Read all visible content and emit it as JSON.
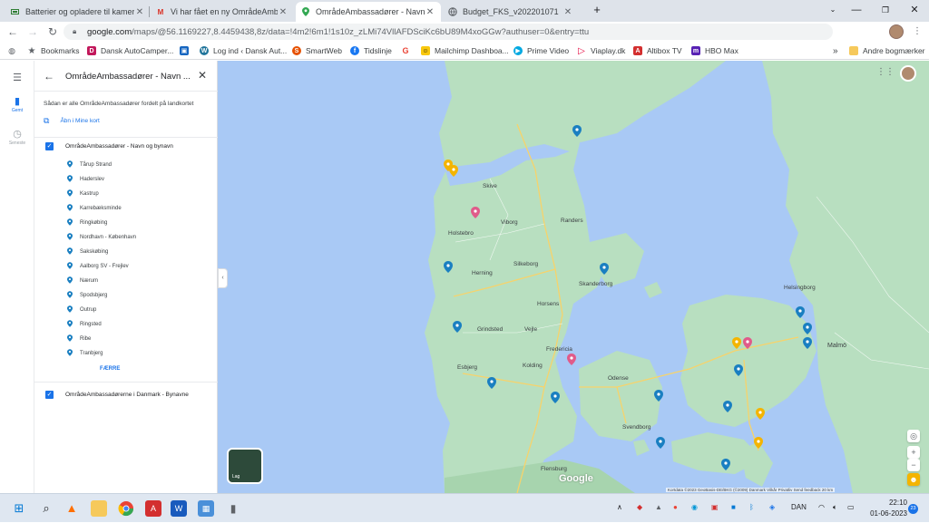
{
  "tabs": [
    {
      "title": "Batterier og opladere til kamerac",
      "icon": "battery-icon",
      "active": false
    },
    {
      "title": "Vi har fået en ny OmrådeAmbassa",
      "icon": "gmail-icon",
      "active": false
    },
    {
      "title": "OmrådeAmbassadører - Navn og",
      "icon": "maps-icon",
      "active": true
    },
    {
      "title": "Budget_FKS_v202201071",
      "icon": "web-icon",
      "active": false
    }
  ],
  "new_tab_label": "+",
  "address": {
    "host": "google.com",
    "path": "/maps/@56.1169227,8.4459438,8z/data=!4m2!6m1!1s10z_zLMi74VllAFDSciKc6bU89M4xoGGw?authuser=0&entry=ttu"
  },
  "bookmarks": [
    {
      "label": "Bookmarks",
      "icon": "star-icon",
      "color": "#5f6368"
    },
    {
      "label": "Dansk AutoCamper...",
      "icon": "camper-icon",
      "color": "#c2185b"
    },
    {
      "label": "",
      "icon": "store-icon",
      "color": "#1565c0"
    },
    {
      "label": "Log ind ‹ Dansk Aut...",
      "icon": "wordpress-icon",
      "color": "#21759b"
    },
    {
      "label": "SmartWeb",
      "icon": "smartweb-icon",
      "color": "#e65100"
    },
    {
      "label": "Tidslinje",
      "icon": "facebook-icon",
      "color": "#1877f2"
    },
    {
      "label": "",
      "icon": "google-icon",
      "color": "#ea4335"
    },
    {
      "label": "Mailchimp Dashboa...",
      "icon": "mailchimp-icon",
      "color": "#f9c80e"
    },
    {
      "label": "Prime Video",
      "icon": "prime-icon",
      "color": "#00a8e1"
    },
    {
      "label": "Viaplay.dk",
      "icon": "viaplay-icon",
      "color": "#e4003a"
    },
    {
      "label": "Altibox TV",
      "icon": "altibox-icon",
      "color": "#d32f2f"
    },
    {
      "label": "HBO Max",
      "icon": "hbo-icon",
      "color": "#5822b4"
    }
  ],
  "bookmarks_more": "»",
  "other_bookmarks": "Andre bogmærker",
  "rail": {
    "saved_label": "Gemt",
    "recent_label": "Seneste"
  },
  "panel": {
    "title": "OmrådeAmbassadører - Navn ...",
    "description": "Sådan er alle OmrådeAmbassadører fordelt på landkortet",
    "open_link": "Åbn i Mine kort",
    "layer1": "OmrådeAmbassadører - Navn og bynavn",
    "places": [
      "Tårup Strand",
      "Haderslev",
      "Kastrup",
      "Karrebæksminde",
      "Ringkøbing",
      "Nordhavn - København",
      "Sakskøbing",
      "Aalborg SV - Frejlev",
      "Nærum",
      "Spodsbjerg",
      "Outrup",
      "Ringsted",
      "Ribe",
      "Tranbjerg"
    ],
    "more_label": "FÆRRE",
    "layer2": "OmrådeAmbassadørerne i Danmark - Bynavne"
  },
  "map": {
    "layer_button": "Lag",
    "logo": "Google",
    "attribution": "Kortdata ©2023 GeoBasis-DE/BKG (©2009)  Danmark  Vilkår  Privatliv  Send feedback  20 km",
    "labels": [
      "Randers",
      "Horsens",
      "Vejle",
      "Fredericia",
      "Kolding",
      "Esbjerg",
      "Odense",
      "Svendborg",
      "Helsingborg",
      "Malmö",
      "Flensburg",
      "Viborg",
      "Herning",
      "Holstebro",
      "Skanderborg",
      "Skive",
      "Silkeborg",
      "Grindsted"
    ],
    "colors": {
      "water": "#a9c9f5",
      "land": "#b8dfc0",
      "land_dark": "#a7d4ae",
      "pin_blue": "#1a7fc1",
      "pin_pink": "#e05b8a",
      "pin_yellow": "#f4b400"
    }
  },
  "taskbar": {
    "lang": "DAN",
    "time": "22:10",
    "date": "01-06-2023",
    "notif_count": "23"
  }
}
